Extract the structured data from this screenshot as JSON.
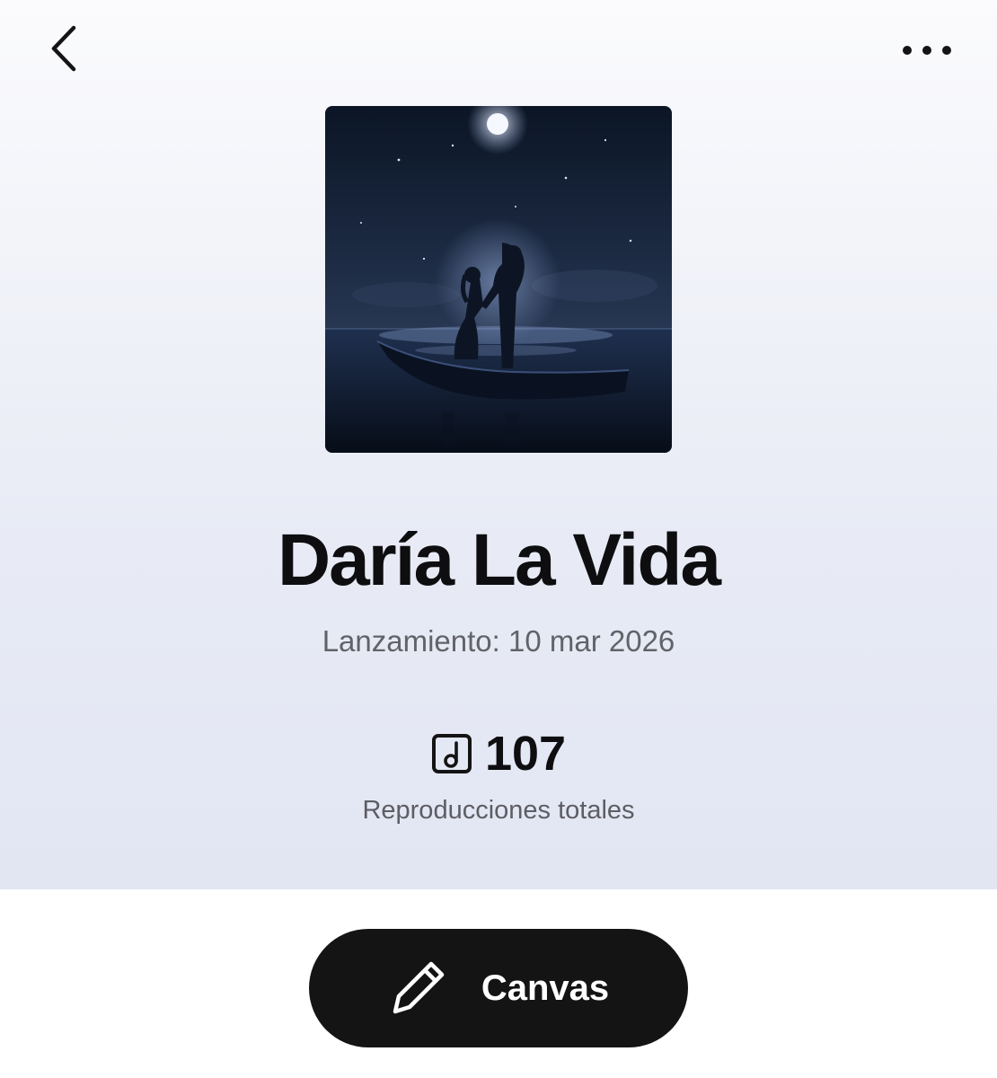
{
  "header": {
    "back_icon": "chevron-left-icon",
    "more_icon": "more-horizontal-icon"
  },
  "release": {
    "title": "Daría La Vida",
    "date_text": "Lanzamiento: 10 mar 2026"
  },
  "stats": {
    "icon": "music-note-square-icon",
    "value": "107",
    "label": "Reproducciones totales"
  },
  "actions": {
    "canvas_label": "Canvas",
    "canvas_icon": "pencil-icon"
  },
  "colors": {
    "button_background": "#141414",
    "title_text": "#0e0e10",
    "secondary_text": "#626269"
  }
}
